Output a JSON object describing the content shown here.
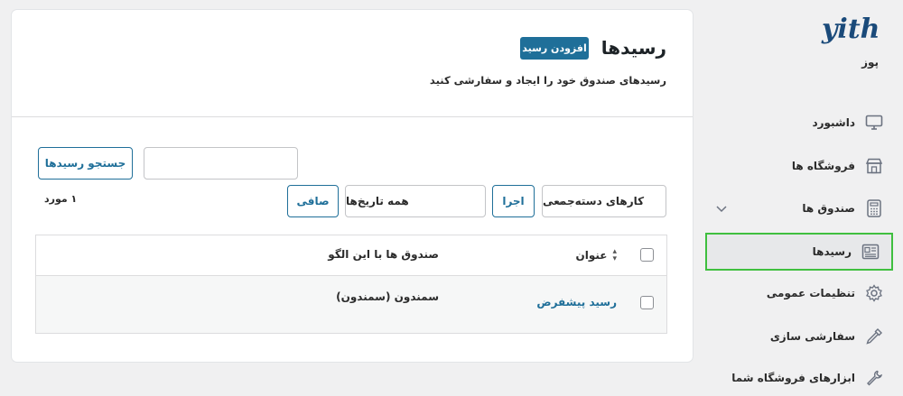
{
  "sidebar": {
    "brand": "yith",
    "subtitle": "پوز",
    "items": [
      {
        "label": "داشبورد",
        "icon": "monitor-icon"
      },
      {
        "label": "فروشگاه ها",
        "icon": "store-icon"
      },
      {
        "label": "صندوق ها",
        "icon": "calculator-icon"
      },
      {
        "label": "رسیدها",
        "icon": "receipt-icon"
      },
      {
        "label": "تنظیمات عمومی",
        "icon": "gear-icon"
      },
      {
        "label": "سفارشی سازی",
        "icon": "eyedropper-icon"
      },
      {
        "label": "ابزارهای فروشگاه شما",
        "icon": "wrench-icon"
      }
    ],
    "active_index": 3
  },
  "header": {
    "title": "رسیدها",
    "add_button": "افزودن رسید",
    "description": "رسیدهای صندوق خود را ایجاد و سفارشی کنید"
  },
  "toolbar": {
    "search_value": "",
    "search_button": "جستجو رسیدها",
    "bulk_actions": "کارهای دسته‌جمعی",
    "apply_button": "اجرا",
    "dates_filter": "همه تاریخ‌ها",
    "filter_button": "صافی",
    "items_count": "۱ مورد"
  },
  "table": {
    "columns": [
      "عنوان",
      "صندوق ها با این الگو"
    ],
    "rows": [
      {
        "title": "رسید پیشفرض",
        "registers": "سمندون (سمندون)"
      }
    ]
  },
  "colors": {
    "accent": "#1f6f99",
    "active_border": "#3fbf3f",
    "brand": "#1a4a7a"
  }
}
